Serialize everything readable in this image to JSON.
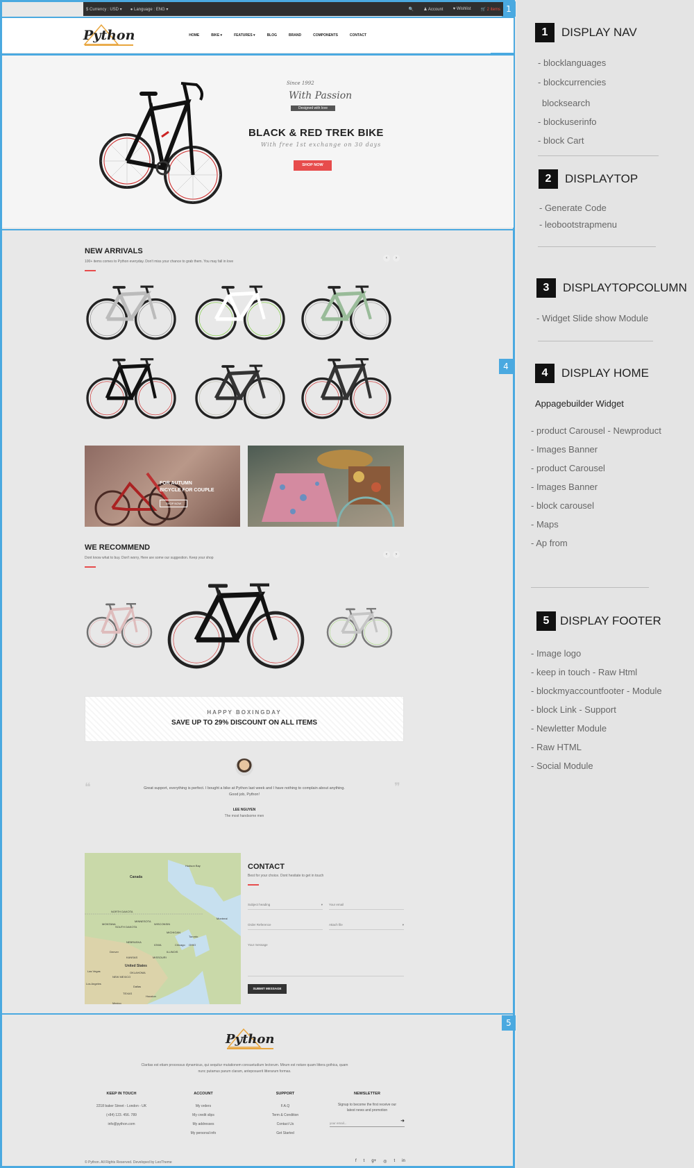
{
  "topbar": {
    "currency": "$ Currency : USD ▾",
    "language": "● Language : ENG ▾",
    "search": "🔍",
    "account": "♟ Account",
    "wishlist": "♥ Wishlist",
    "cart": "🛒 2 items"
  },
  "header": {
    "logo": "Python",
    "menu": [
      "HOME",
      "BIKE ▾",
      "FEATURES ▾",
      "BLOG",
      "BRAND",
      "COMPONENTS",
      "CONTACT"
    ]
  },
  "slider": {
    "since": "Since 1992",
    "passion": "With Passion",
    "ribbon": "Designed with love",
    "title": "BLACK & RED TREK BIKE",
    "subtitle": "With free 1st exchange on 30 days",
    "button": "SHOP NOW"
  },
  "new_arrivals": {
    "title": "NEW ARRIVALS",
    "subtitle": "100+ items comes to Python everyday. Don't miss your chance to grab them. You may fall in love"
  },
  "banners": {
    "left_line1": "FOR AUTUMN",
    "left_line2": "BICYCLE FOR COUPLE",
    "left_button": "SHOP NOW"
  },
  "recommend": {
    "title": "WE RECOMMEND",
    "subtitle": "Dont know what to buy. Don't worry, Here are some our suggestion. Keep your shop"
  },
  "boxing": {
    "line1": "HAPPY BOXINGDAY",
    "line2": "SAVE UP TO 29% DISCOUNT ON ALL ITEMS"
  },
  "testimonial": {
    "quote": "Great support, everything is perfect. I bought a bike at Python last week and I have nothing to complain about anything. Good job, Python!",
    "name": "LEE NGUYEN",
    "role": "The most handsome men"
  },
  "map": {
    "labels": [
      "Hudson Bay",
      "Canada",
      "MONTANA",
      "NORTH DAKOTA",
      "SOUTH DAKOTA",
      "MINNESOTA",
      "WISCONSIN",
      "MICHIGAN",
      "OHIO",
      "IOWA",
      "NEBRASKA",
      "KANSAS",
      "MISSOURI",
      "ILLINOIS",
      "United States",
      "NEW MEXICO",
      "TEXAS",
      "OKLAHOMA",
      "Chicago",
      "Toronto",
      "Montreal",
      "Denver",
      "Houston",
      "Dallas",
      "Las Vegas",
      "Los Angeles",
      "Mexico"
    ]
  },
  "contact": {
    "title": "CONTACT",
    "subtitle": "Best for your choice. Dont hesitate to get in touch",
    "subject": "Subject heading",
    "email": "Your email",
    "order": "Order Reference",
    "attach": "Attach file",
    "message": "Your message",
    "submit": "SUBMIT MESSAGE"
  },
  "footer": {
    "logo": "Python",
    "about": "Claritas est etiam processus dynamicus, qui sequitur mutationem consuetudium lectorum. Mirum est notare quam littera gothica, quam nunc putamus parum claram, anteposuerit litterarum formas.",
    "keep": {
      "h": "KEEP IN TOUCH",
      "items": [
        "2218 baker Street - London - UK",
        "(+84) 123. 456. 789",
        "info@python.com"
      ]
    },
    "account": {
      "h": "ACCOUNT",
      "items": [
        "My orders",
        "My credit slips",
        "My addresses",
        "My personal info"
      ]
    },
    "support": {
      "h": "SUPPORT",
      "items": [
        "F.A.Q",
        "Term & Condition",
        "Contact Us",
        "Get Started"
      ]
    },
    "newsletter": {
      "h": "NEWSLETTER",
      "text": "Signup to become the first receive our latest news and promotion",
      "placeholder": "your email..."
    },
    "copyright": "© Python. All Rights Reserved. Developed by LeoTheme",
    "social": [
      "f",
      "t",
      "g+",
      "◎",
      "t",
      "in"
    ]
  },
  "markers": [
    "1",
    "2",
    "3",
    "4",
    "5"
  ],
  "panel": {
    "s1": {
      "num": "1",
      "title": "DISPLAY NAV",
      "items": [
        "-  blocklanguages",
        "-  blockcurrencies",
        "blocksearch",
        "-  blockuserinfo",
        "-  block Cart"
      ]
    },
    "s2": {
      "num": "2",
      "title": "DISPLAYTOP",
      "items": [
        "-  Generate Code",
        "-  leobootstrapmenu"
      ]
    },
    "s3": {
      "num": "3",
      "title": "DISPLAYTOPCOLUMN",
      "items": [
        "-  Widget  Slide show Module"
      ]
    },
    "s4": {
      "num": "4",
      "title": "DISPLAY  HOME",
      "sub": "Appagebuilder  Widget",
      "items": [
        "-  product Carousel - Newproduct",
        "-  Images Banner",
        "-  product Carousel",
        "-  Images Banner",
        "- block carousel",
        "- Maps",
        "- Ap from"
      ]
    },
    "s5": {
      "num": "5",
      "title": "DISPLAY  FOOTER",
      "items": [
        "- Image logo",
        "-  keep in touch -  Raw Html",
        "-  blockmyaccountfooter - Module",
        "-  block Link  -  Support",
        "-  Newletter Module",
        "-   Raw HTML",
        "-  Social Module"
      ]
    }
  }
}
